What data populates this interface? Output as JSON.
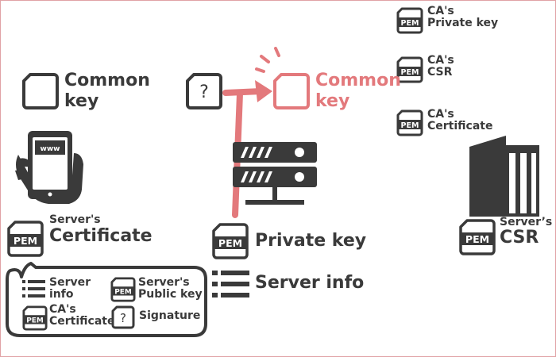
{
  "colors": {
    "dark": "#3a3a3a",
    "accent": "#e3797c",
    "border": "#e0a2a5"
  },
  "icons": {
    "pem_text": "PEM",
    "unknown_text": "?",
    "browser_text": "www"
  },
  "ca": {
    "private_key": {
      "line1": "CA's",
      "line2": "Private key"
    },
    "csr": {
      "line1": "CA's",
      "line2": "CSR"
    },
    "certificate": {
      "line1": "CA's",
      "line2": "Certificate"
    }
  },
  "client": {
    "common_key": {
      "line1": "Common",
      "line2": "key"
    },
    "server_certificate": {
      "line1": "Server's",
      "line2": "Certificate"
    },
    "bubble": {
      "server_info": {
        "line1": "Server",
        "line2": "info"
      },
      "public_key": {
        "line1": "Server's",
        "line2": "Public key"
      },
      "ca_certificate": {
        "line1": "CA's",
        "line2": "Certificate"
      },
      "signature": "Signature"
    }
  },
  "server": {
    "common_key": {
      "line1": "Common",
      "line2": "key"
    },
    "private_key": "Private key",
    "server_info": "Server info"
  },
  "ca_side": {
    "server_csr": {
      "line1": "Server’s",
      "line2": "CSR"
    }
  }
}
